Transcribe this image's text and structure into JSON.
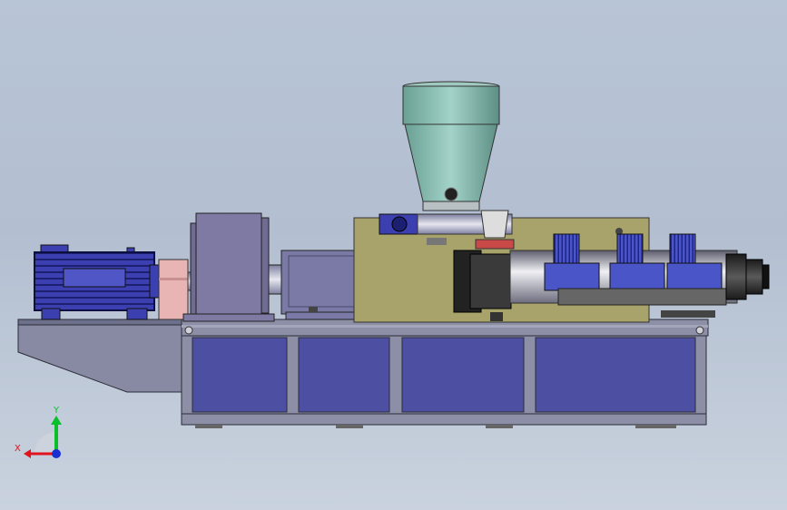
{
  "viewport": {
    "background_top": "#b8c5d6",
    "background_bottom": "#c9d2de"
  },
  "triad": {
    "y_label": "Y",
    "x_label": "X",
    "y_color": "#0bbf2a",
    "x_color": "#e0141e",
    "z_color": "#1a2fd0"
  },
  "colors": {
    "base_frame": "#8d8fa6",
    "base_panel": "#4d4fa3",
    "motor": "#3b3fb0",
    "coupling": "#e8b4b4",
    "gearbox": "#7f7aa3",
    "barrel_housing": "#7b7aa6",
    "yellow_plate": "#a8a36a",
    "hopper": "#86b8ad",
    "heater_fan": "#4a55c7",
    "die_head": "#2a2a2a"
  }
}
